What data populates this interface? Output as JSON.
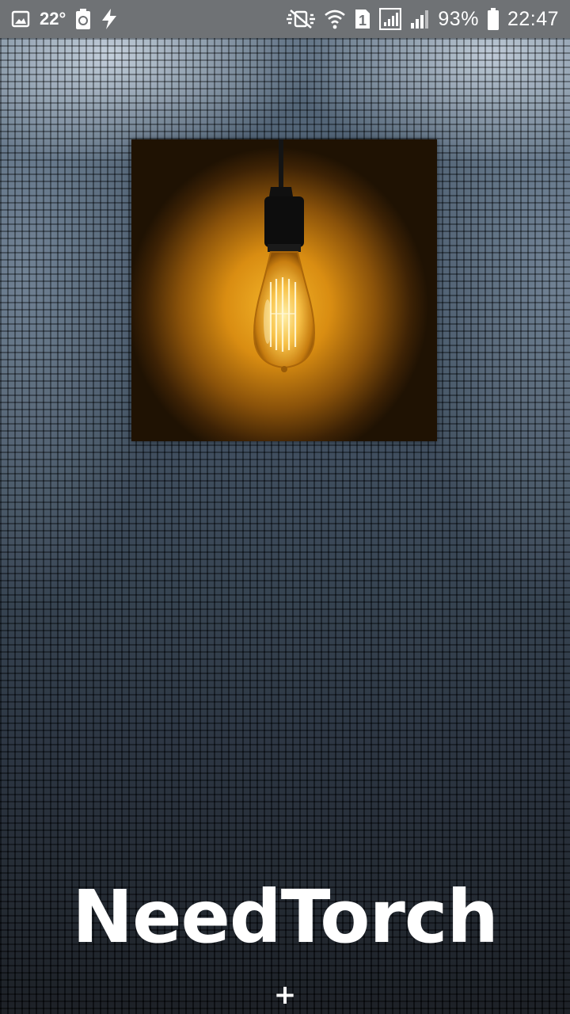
{
  "status_bar": {
    "temperature": "22°",
    "battery_percent": "93%",
    "time": "22:47",
    "icons": [
      "gallery-icon",
      "recycle-battery-icon",
      "flash-icon",
      "mute-vibrate-icon",
      "wifi-icon",
      "sim-1-icon",
      "signal-icon",
      "signal-icon",
      "battery-icon"
    ]
  },
  "app": {
    "title": "NeedTorch",
    "plus_label": "+"
  },
  "colors": {
    "status_bar_bg": "#6f7275",
    "bulb_glow": "#f4b52a",
    "title_text": "#ffffff"
  }
}
